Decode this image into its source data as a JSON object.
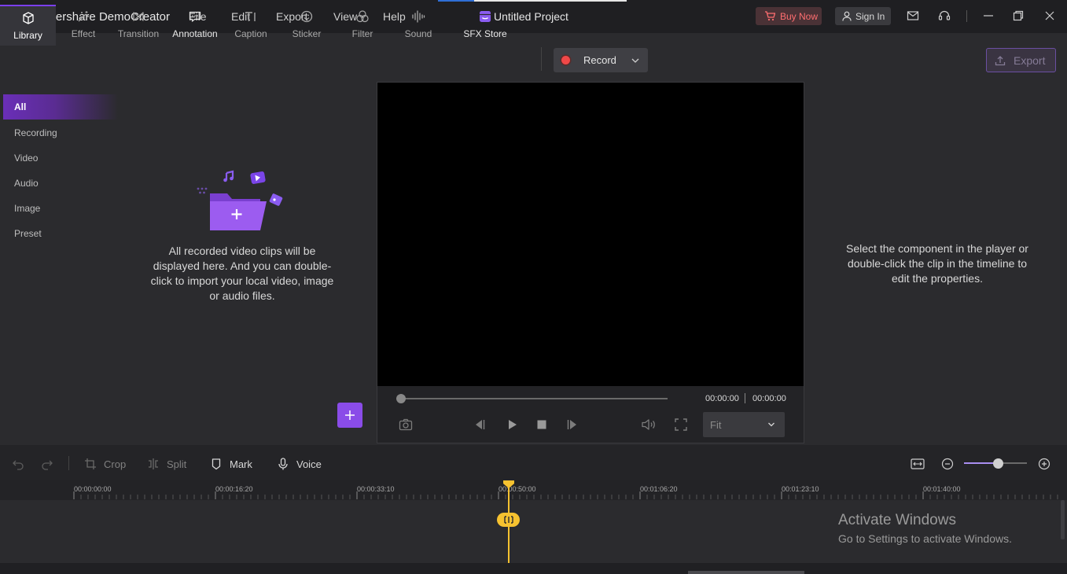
{
  "app": {
    "name": "Wondershare DemoCreator",
    "project_title": "Untitled Project",
    "menu": [
      "File",
      "Edit",
      "Export",
      "View",
      "Help"
    ],
    "buy_now": "Buy Now",
    "sign_in": "Sign In"
  },
  "toolbar": {
    "tabs": [
      {
        "label": "Library",
        "icon": "box-icon",
        "active": true
      },
      {
        "label": "Effect",
        "icon": "magic-wand-icon"
      },
      {
        "label": "Transition",
        "icon": "bowtie-icon"
      },
      {
        "label": "Annotation",
        "icon": "speech-bubble-icon"
      },
      {
        "label": "Caption",
        "icon": "text-caption-icon"
      },
      {
        "label": "Sticker",
        "icon": "smiley-icon"
      },
      {
        "label": "Filter",
        "icon": "circles-icon"
      },
      {
        "label": "Sound",
        "icon": "waveform-icon"
      },
      {
        "label": "SFX Store",
        "icon": "store-icon"
      }
    ],
    "record_label": "Record",
    "export_label": "Export"
  },
  "library": {
    "categories": [
      "All",
      "Recording",
      "Video",
      "Audio",
      "Image",
      "Preset"
    ],
    "selected": "All",
    "empty_line_1": "All recorded video clips will be",
    "empty_line_2": "displayed here. And you can double-",
    "empty_line_3": "click to import your local video, image",
    "empty_line_4": "or audio files."
  },
  "player": {
    "current_time": "00:00:00",
    "total_time": "00:00:00",
    "progress": 0,
    "fit_value": "Fit"
  },
  "properties": {
    "line_1": "Select the component in the player or",
    "line_2": "double-click the clip in the timeline to",
    "line_3": "edit the properties."
  },
  "edit_bar": {
    "crop": "Crop",
    "split": "Split",
    "mark": "Mark",
    "voice": "Voice",
    "zoom_level": 0.54
  },
  "timeline": {
    "ticks": [
      "00:00:00:00",
      "00:00:16:20",
      "00:00:33:10",
      "00:00:50:00",
      "00:01:06:20",
      "00:01:23:10",
      "00:01:40:00"
    ],
    "playhead_time": "00:00:50:00"
  },
  "watermark": {
    "title": "Activate Windows",
    "subtitle": "Go to Settings to activate Windows."
  },
  "colors": {
    "accent": "#7b3ff2",
    "playhead": "#f6c230",
    "record": "#f04848",
    "buy": "#ff6e70"
  }
}
